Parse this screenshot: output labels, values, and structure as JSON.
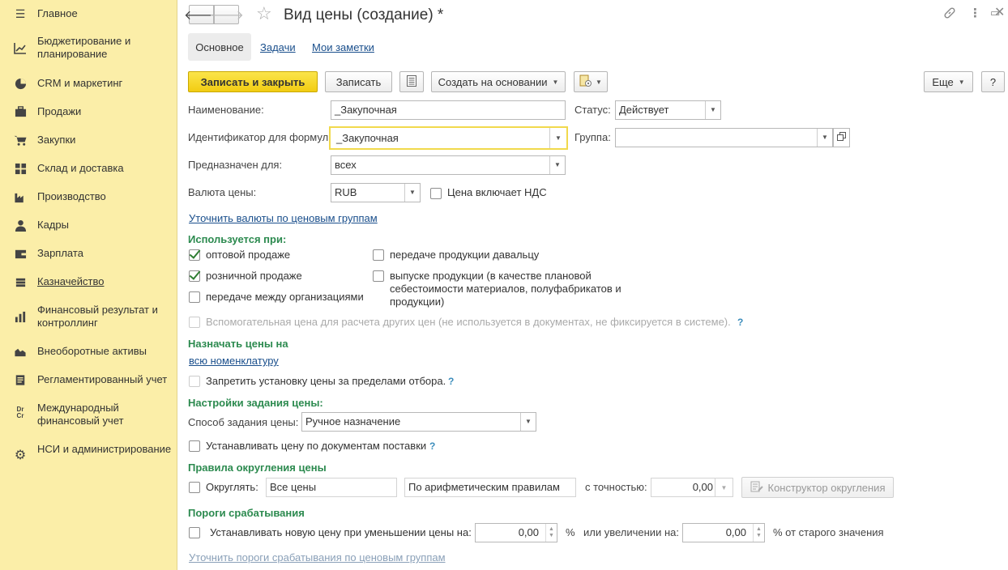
{
  "sidebar": {
    "items": [
      {
        "label": "Главное",
        "icon": "menu-icon"
      },
      {
        "label": "Бюджетирование и планирование",
        "icon": "chart-icon"
      },
      {
        "label": "CRM и маркетинг",
        "icon": "pie-icon"
      },
      {
        "label": "Продажи",
        "icon": "briefcase-icon"
      },
      {
        "label": "Закупки",
        "icon": "cart-icon"
      },
      {
        "label": "Склад и доставка",
        "icon": "grid-icon"
      },
      {
        "label": "Производство",
        "icon": "factory-icon"
      },
      {
        "label": "Кадры",
        "icon": "person-icon"
      },
      {
        "label": "Зарплата",
        "icon": "wallet-icon"
      },
      {
        "label": "Казначейство",
        "icon": "coins-icon"
      },
      {
        "label": "Финансовый результат и контроллинг",
        "icon": "bars-icon"
      },
      {
        "label": "Внеоборотные активы",
        "icon": "assets-icon"
      },
      {
        "label": "Регламентированный учет",
        "icon": "document-icon"
      },
      {
        "label": "Международный финансовый учет",
        "icon": "dr-cr-icon",
        "icon_text": "Dr Cr"
      },
      {
        "label": "НСИ и администрирование",
        "icon": "gear-icon"
      }
    ]
  },
  "header": {
    "title": "Вид цены (создание) *",
    "tabs": [
      "Основное",
      "Задачи",
      "Мои заметки"
    ]
  },
  "toolbar": {
    "save_close": "Записать и закрыть",
    "save": "Записать",
    "create_based": "Создать на основании",
    "more": "Еще",
    "help": "?"
  },
  "form": {
    "name_label": "Наименование:",
    "name_value": "_Закупочная",
    "status_label": "Статус:",
    "status_value": "Действует",
    "formula_id_label": "Идентификатор для формул:",
    "formula_id_value": "_Закупочная",
    "group_label": "Группа:",
    "group_value": "",
    "intended_label": "Предназначен для:",
    "intended_value": "всех",
    "currency_label": "Валюта цены:",
    "currency_value": "RUB",
    "vat_label": "Цена включает НДС",
    "vat_checked": false,
    "currency_link": "Уточнить валюты по ценовым группам"
  },
  "used_for": {
    "title": "Используется при:",
    "wholesale": "оптовой продаже",
    "retail": "розничной продаже",
    "between_orgs": "передаче между организациями",
    "to_supplier": "передаче продукции давальцу",
    "production": "выпуске продукции (в качестве плановой",
    "production_line2": "себестоимости материалов, полуфабрикатов и",
    "production_line3": "продукции)",
    "auxiliary": "Вспомогательная цена для расчета других цен (не используется в документах, не фиксируется в системе).",
    "help": "?"
  },
  "assign": {
    "title": "Назначать цены на",
    "link": "всю номенклатуру",
    "forbid": "Запретить установку цены за пределами отбора.",
    "help": "?"
  },
  "settings": {
    "title": "Настройки задания цены:",
    "method_label": "Способ задания цены:",
    "method_value": "Ручное назначение",
    "by_docs": "Устанавливать цену по документам поставки",
    "help": "?"
  },
  "rounding": {
    "title": "Правила округления цены",
    "round_label": "Округлять:",
    "all_prices": "Все цены",
    "rule": "По арифметическим правилам",
    "precision_label": "с точностью:",
    "precision_value": "0,00",
    "constructor": "Конструктор округления"
  },
  "thresholds": {
    "title": "Пороги срабатывания",
    "decrease_label": "Устанавливать новую цену при уменьшении цены на:",
    "decrease_value": "0,00",
    "percent": "%",
    "increase_label": "или увеличении на:",
    "increase_value": "0,00",
    "suffix": "% от старого значения",
    "link": "Уточнить пороги срабатывания по ценовым группам"
  }
}
